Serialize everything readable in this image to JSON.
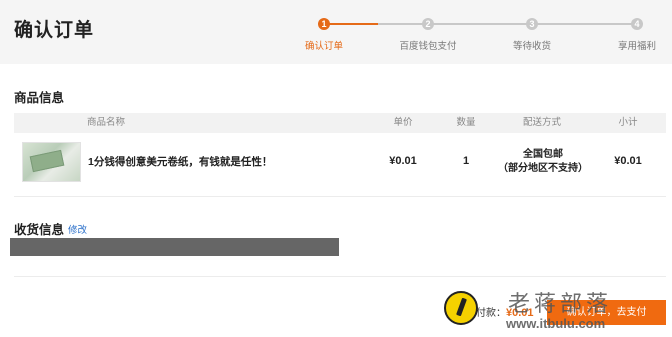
{
  "header": {
    "title": "确认订单",
    "steps": [
      {
        "num": "1",
        "label": "确认订单",
        "active": true
      },
      {
        "num": "2",
        "label": "百度钱包支付",
        "active": false
      },
      {
        "num": "3",
        "label": "等待收货",
        "active": false
      },
      {
        "num": "4",
        "label": "享用福利",
        "active": false
      }
    ]
  },
  "product_section": {
    "title": "商品信息",
    "columns": [
      "商品名称",
      "单价",
      "数量",
      "配送方式",
      "小计"
    ],
    "row": {
      "name": "1分钱得创意美元卷纸，有钱就是任性！",
      "price": "¥0.01",
      "quantity": "1",
      "shipping_line1": "全国包邮",
      "shipping_line2": "（部分地区不支持）",
      "subtotal": "¥0.01"
    }
  },
  "address_section": {
    "title": "收货信息",
    "edit_label": "修改"
  },
  "footer": {
    "total_label": "付款：",
    "total_amount": "¥0.01",
    "pay_button": "确认订单，去支付"
  },
  "watermark": {
    "text": "老蒋部落",
    "url": "www.itbulu.com"
  },
  "colors": {
    "accent": "#e56a18",
    "inactive": "#bdbdbd",
    "link": "#2a6fc9"
  }
}
